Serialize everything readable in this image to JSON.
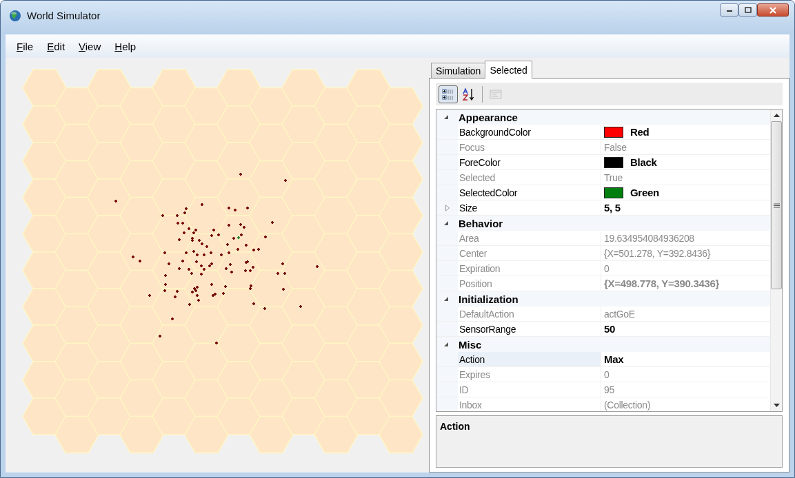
{
  "window": {
    "title": "World Simulator"
  },
  "menu": [
    {
      "label": "File"
    },
    {
      "label": "Edit"
    },
    {
      "label": "View"
    },
    {
      "label": "Help"
    }
  ],
  "tabs": [
    {
      "label": "Simulation",
      "selected": false
    },
    {
      "label": "Selected",
      "selected": true
    }
  ],
  "toolbar": [
    {
      "kind": "categorized",
      "pressed": true,
      "disabled": false
    },
    {
      "kind": "alphabetical",
      "pressed": false,
      "disabled": false
    },
    {
      "kind": "property-pages",
      "pressed": false,
      "disabled": true
    }
  ],
  "properties": [
    {
      "category": "Appearance",
      "expanded": true,
      "items": [
        {
          "name": "BackgroundColor",
          "value": "Red",
          "kind": "color",
          "color": "#ff0000",
          "readonly": false,
          "modified": true,
          "selected": false
        },
        {
          "name": "Focus",
          "value": "False",
          "kind": "text",
          "readonly": true,
          "modified": false,
          "selected": false
        },
        {
          "name": "ForeColor",
          "value": "Black",
          "kind": "color",
          "color": "#000000",
          "readonly": false,
          "modified": true,
          "selected": false
        },
        {
          "name": "Selected",
          "value": "True",
          "kind": "text",
          "readonly": true,
          "modified": false,
          "selected": false
        },
        {
          "name": "SelectedColor",
          "value": "Green",
          "kind": "color",
          "color": "#007f0e",
          "readonly": false,
          "modified": true,
          "selected": false
        },
        {
          "name": "Size",
          "value": "5, 5",
          "kind": "expandable",
          "readonly": false,
          "modified": true,
          "selected": false
        }
      ]
    },
    {
      "category": "Behavior",
      "expanded": true,
      "items": [
        {
          "name": "Area",
          "value": "19.634954084936208",
          "kind": "text",
          "readonly": true,
          "modified": false,
          "selected": false
        },
        {
          "name": "Center",
          "value": "{X=501.278, Y=392.8436}",
          "kind": "text",
          "readonly": true,
          "modified": false,
          "selected": false
        },
        {
          "name": "Expiration",
          "value": "0",
          "kind": "text",
          "readonly": true,
          "modified": false,
          "selected": false
        },
        {
          "name": "Position",
          "value": "{X=498.778, Y=390.3436}",
          "kind": "text",
          "readonly": true,
          "modified": true,
          "selected": false
        }
      ]
    },
    {
      "category": "Initialization",
      "expanded": true,
      "items": [
        {
          "name": "DefaultAction",
          "value": "actGoE",
          "kind": "text",
          "readonly": true,
          "modified": false,
          "selected": false
        },
        {
          "name": "SensorRange",
          "value": "50",
          "kind": "text",
          "readonly": false,
          "modified": true,
          "selected": false
        }
      ]
    },
    {
      "category": "Misc",
      "expanded": true,
      "items": [
        {
          "name": "Action",
          "value": "Max",
          "kind": "text",
          "readonly": false,
          "modified": true,
          "selected": true
        },
        {
          "name": "Expires",
          "value": "0",
          "kind": "text",
          "readonly": true,
          "modified": false,
          "selected": false
        },
        {
          "name": "ID",
          "value": "95",
          "kind": "text",
          "readonly": true,
          "modified": false,
          "selected": false
        },
        {
          "name": "Inbox",
          "value": "(Collection)",
          "kind": "text",
          "readonly": true,
          "modified": false,
          "selected": false
        }
      ]
    }
  ],
  "description": {
    "title": "Action"
  }
}
